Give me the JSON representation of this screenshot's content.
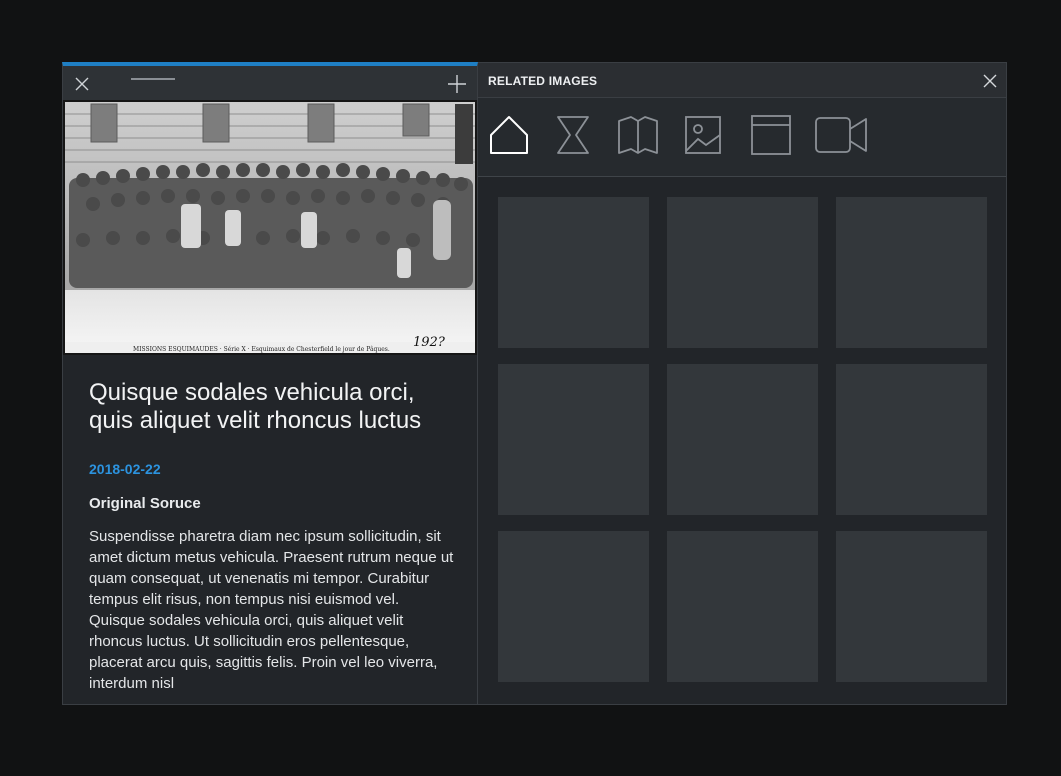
{
  "left_panel": {
    "toolbar": {
      "close_icon": "close-icon",
      "drag_handle": "drag-handle",
      "add_icon": "plus-icon"
    },
    "photo": {
      "caption": "MISSIONS ESQUIMAUDES · Série X · Esquimaux de Chesterfield le jour de Pâques.",
      "handwritten_note": "192?"
    },
    "article": {
      "title": "Quisque sodales vehicula orci, quis aliquet velit rhoncus luctus",
      "date": "2018-02-22",
      "source_heading": "Original Soruce",
      "body": "Suspendisse pharetra diam nec ipsum sollicitudin, sit amet dictum metus vehicula. Praesent rutrum neque ut quam consequat, ut venenatis mi tempor. Curabitur tempus elit risus, non tempus nisi euismod vel. Quisque sodales vehicula orci, quis aliquet velit rhoncus luctus. Ut sollicitudin eros pellentesque, placerat arcu quis, sagittis felis. Proin vel leo viverra, interdum nisl"
    }
  },
  "right_panel": {
    "title": "RELATED IMAGES",
    "close_icon": "close-icon",
    "type_filters": [
      {
        "name": "home-icon",
        "active": true
      },
      {
        "name": "hourglass-icon",
        "active": false
      },
      {
        "name": "book-icon",
        "active": false
      },
      {
        "name": "image-icon",
        "active": false
      },
      {
        "name": "window-icon",
        "active": false
      },
      {
        "name": "video-camera-icon",
        "active": false
      }
    ],
    "grid_tile_count": 9
  },
  "colors": {
    "accent": "#1f7fc4",
    "date": "#2c93df",
    "panel_bg": "#222529",
    "tile_bg": "#33373b",
    "page_bg": "#111213"
  }
}
